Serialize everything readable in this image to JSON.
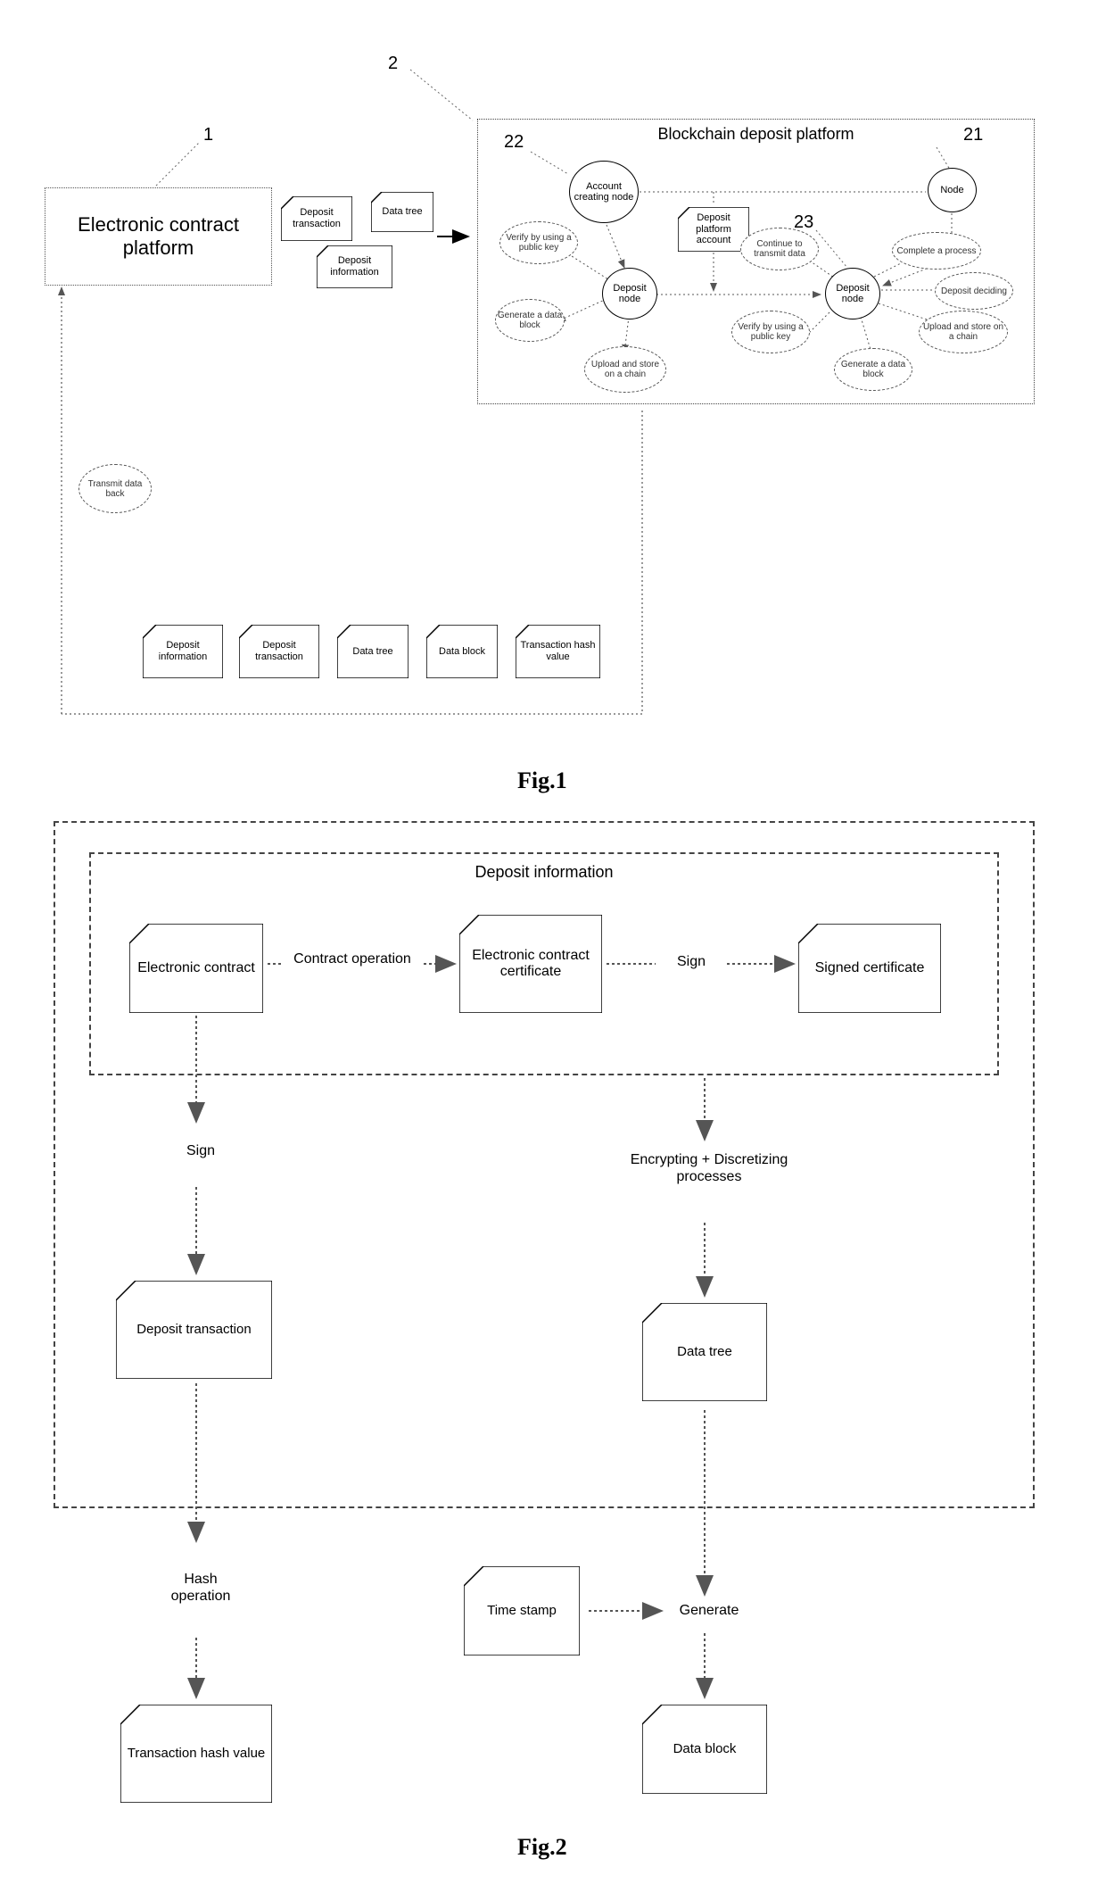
{
  "fig1": {
    "caption": "Fig.1",
    "ecp": "Electronic contract platform",
    "dt": "Deposit transaction",
    "di": "Deposit information",
    "dtree": "Data tree",
    "bcdp_title": "Blockchain deposit platform",
    "acn": "Account creating node",
    "node": "Node",
    "dpa": "Deposit platform account",
    "dep_node": "Deposit node",
    "verify": "Verify by using a public key",
    "gen_block": "Generate a data block",
    "upload": "Upload and store on a chain",
    "cont_trans": "Continue to transmit data",
    "complete": "Complete a process",
    "dep_decide": "Deposit deciding",
    "ref_1": "1",
    "ref_2": "2",
    "ref_22": "22",
    "ref_21": "21",
    "ref_23": "23",
    "ret_di": "Deposit information",
    "ret_dt": "Deposit transaction",
    "ret_dtree": "Data tree",
    "ret_dblock": "Data block",
    "ret_thash": "Transaction hash value",
    "tdb": "Transmit data back"
  },
  "fig2": {
    "caption": "Fig.2",
    "di_title": "Deposit information",
    "econtract": "Electronic contract",
    "contract_op": "Contract operation",
    "ecc": "Electronic contract certificate",
    "sign": "Sign",
    "signed_cert": "Signed certificate",
    "dep_trans": "Deposit transaction",
    "enc": "Encrypting + Discretizing processes",
    "dtree": "Data tree",
    "hash_op": "Hash operation",
    "thash": "Transaction hash value",
    "timestamp": "Time stamp",
    "generate": "Generate",
    "dblock": "Data block"
  }
}
